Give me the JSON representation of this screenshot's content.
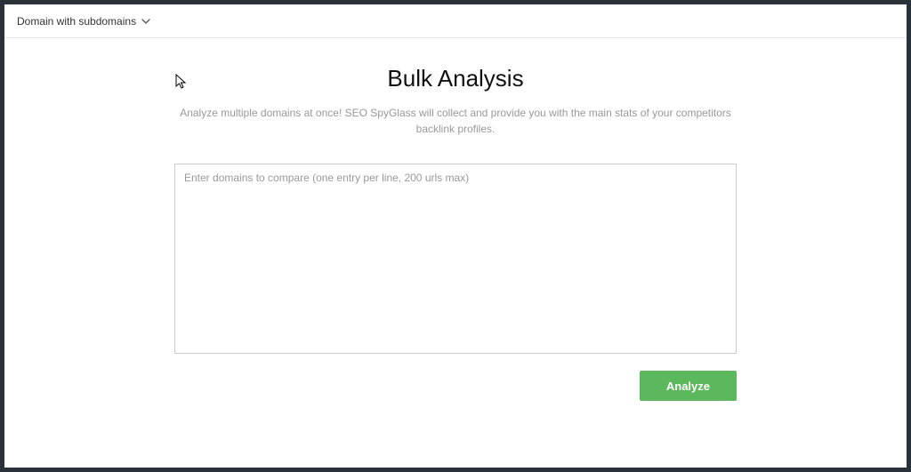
{
  "topbar": {
    "domain_dropdown": {
      "selected": "Domain with subdomains"
    }
  },
  "main": {
    "title": "Bulk Analysis",
    "subtitle": "Analyze multiple domains at once! SEO SpyGlass will collect and provide you with the main stats of your competitors backlink profiles.",
    "input_placeholder": "Enter domains to compare (one entry per line, 200 urls max)",
    "analyze_label": "Analyze"
  }
}
